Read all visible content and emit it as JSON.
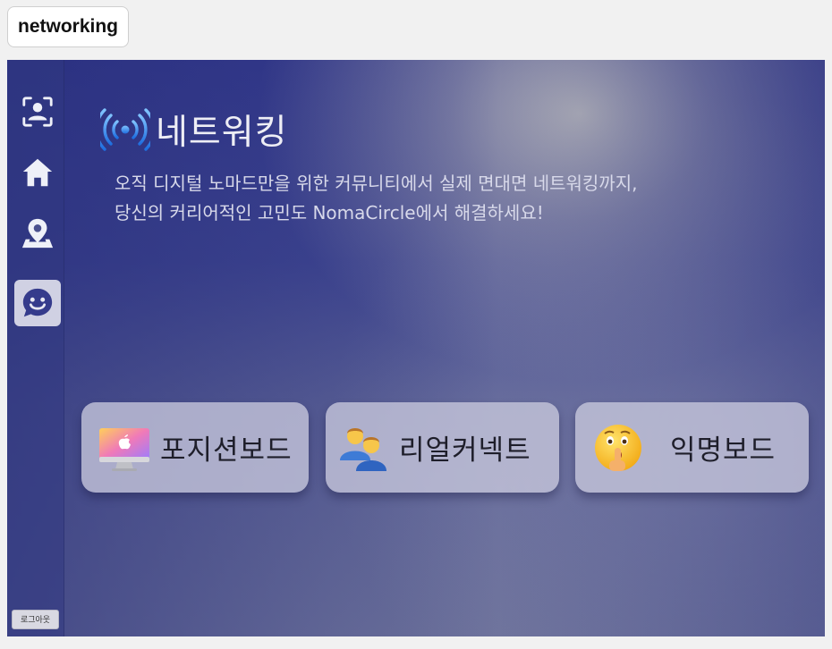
{
  "browser_tab": {
    "label": "networking"
  },
  "sidebar": {
    "items": [
      {
        "name": "profile",
        "icon": "user-scan-icon",
        "active": false
      },
      {
        "name": "home",
        "icon": "home-icon",
        "active": false
      },
      {
        "name": "map",
        "icon": "map-pin-icon",
        "active": false
      },
      {
        "name": "networking",
        "icon": "smiley-chat-icon",
        "active": true
      }
    ],
    "logout_label": "로그아웃"
  },
  "main": {
    "title": "네트워킹",
    "title_icon": "broadcast-signal-icon",
    "description_line1": "오직 디지털 노마드만을 위한 커뮤니티에서 실제 면대면 네트워킹까지,",
    "description_line2": "당신의 커리어적인 고민도 NomaCircle에서 해결하세요!",
    "cards": [
      {
        "label": "포지션보드",
        "icon": "computer-monitor-icon"
      },
      {
        "label": "리얼커넥트",
        "icon": "two-people-icon"
      },
      {
        "label": "익명보드",
        "icon": "shushing-face-icon"
      }
    ]
  },
  "colors": {
    "accent": "#3a3f8f",
    "sidebar_icon": "#eef0f8",
    "active_icon": "#353b8c"
  }
}
